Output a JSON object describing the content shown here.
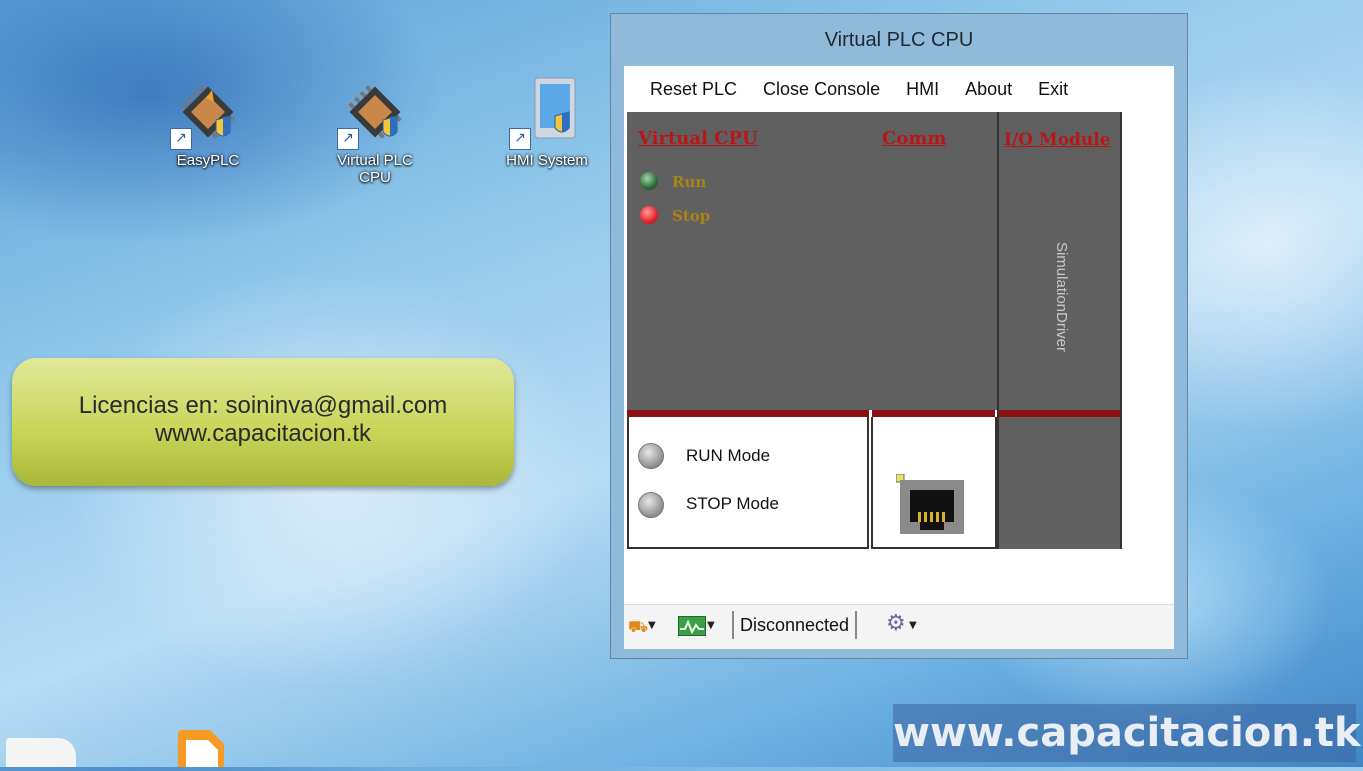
{
  "desktop": {
    "icons": [
      {
        "label": "EasyPLC"
      },
      {
        "label": "Virtual PLC CPU"
      },
      {
        "label": "HMI System"
      }
    ]
  },
  "info_box": {
    "line1": "Licencias en: soininva@gmail.com",
    "line2": "www.capacitacion.tk"
  },
  "window": {
    "title": "Virtual PLC CPU",
    "menu": [
      "Reset PLC",
      "Close Console",
      "HMI",
      "About",
      "Exit"
    ],
    "cpu": {
      "heading": "Virtual CPU",
      "run_label": "Run",
      "stop_label": "Stop"
    },
    "comm": {
      "heading": "Comm"
    },
    "io": {
      "heading": "I/O Module",
      "driver": "SimulationDriver"
    },
    "modes": {
      "run": "RUN Mode",
      "stop": "STOP Mode"
    },
    "status": {
      "connection": "Disconnected"
    }
  },
  "watermark": "www.capacitacion.tk",
  "colors": {
    "panel": "#606060",
    "red_heading": "#b81616",
    "led_label": "#a98315",
    "led_green": "#2f6b3a",
    "led_red": "#e2232a"
  }
}
